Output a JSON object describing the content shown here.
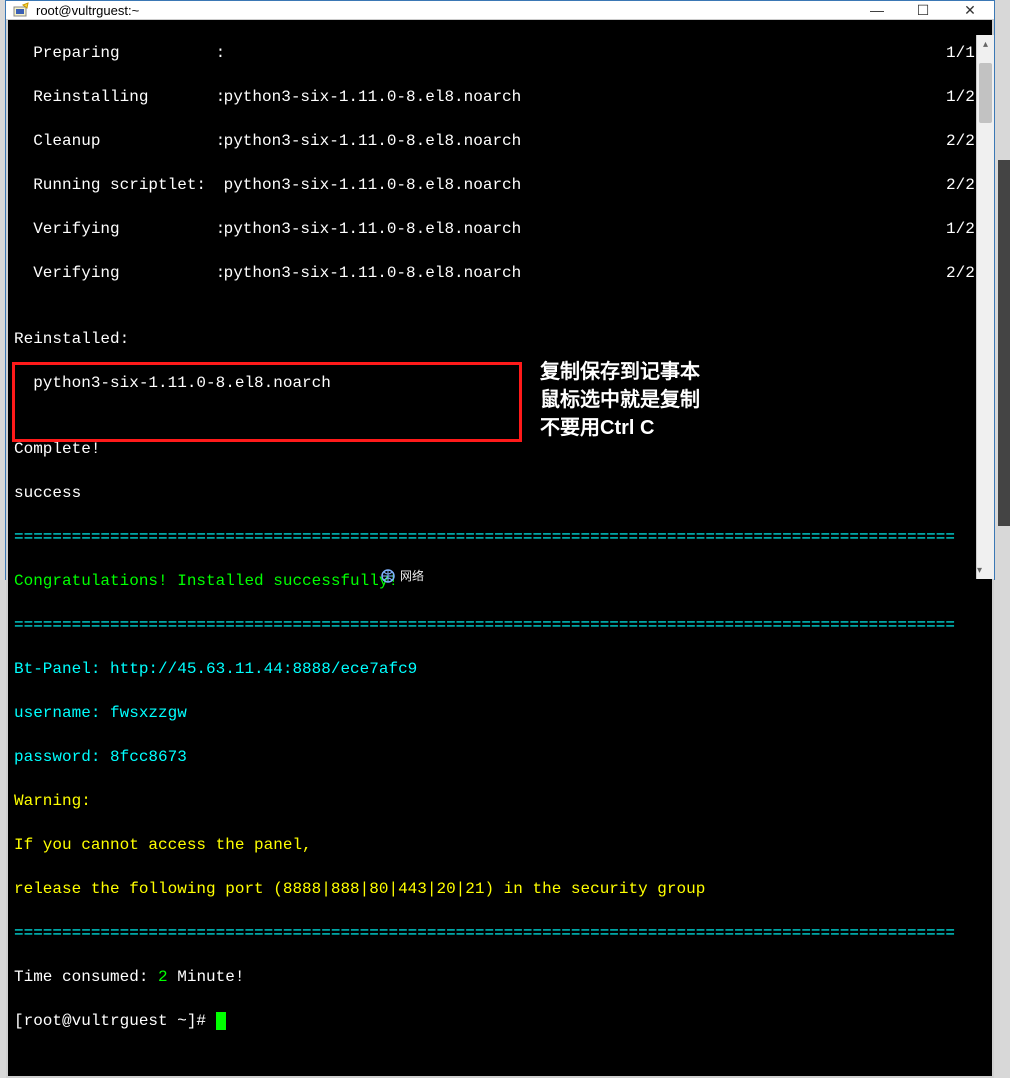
{
  "window": {
    "title": "root@vultrguest:~",
    "min_label": "—",
    "max_label": "☐",
    "close_label": "✕"
  },
  "install": {
    "rows": [
      {
        "label": "  Preparing          :",
        "pkg": "",
        "count": "1/1"
      },
      {
        "label": "  Reinstalling       :",
        "pkg": " python3-six-1.11.0-8.el8.noarch",
        "count": "1/2"
      },
      {
        "label": "  Cleanup            :",
        "pkg": " python3-six-1.11.0-8.el8.noarch",
        "count": "2/2"
      },
      {
        "label": "  Running scriptlet:",
        "pkg": " python3-six-1.11.0-8.el8.noarch",
        "count": "2/2"
      },
      {
        "label": "  Verifying          :",
        "pkg": " python3-six-1.11.0-8.el8.noarch",
        "count": "1/2"
      },
      {
        "label": "  Verifying          :",
        "pkg": " python3-six-1.11.0-8.el8.noarch",
        "count": "2/2"
      }
    ],
    "blank1": "",
    "reinstalled_hdr": "Reinstalled:",
    "reinstalled_pkg": "  python3-six-1.11.0-8.el8.noarch",
    "blank2": "",
    "complete": "Complete!",
    "success": "success",
    "divider1": "==================================================================================================",
    "congrats": "Congratulations! Installed successfully!",
    "divider2": "==================================================================================================",
    "panel_url": "Bt-Panel: http://45.63.11.44:8888/ece7afc9",
    "username": "username: fwsxzzgw",
    "password": "password: 8fcc8673",
    "warning_hdr": "Warning:",
    "warn_line1": "If you cannot access the panel, ",
    "warn_line2": "release the following port (8888|888|80|443|20|21) in the security group",
    "divider3": "==================================================================================================",
    "time_pre": "Time consumed: ",
    "time_val": "2",
    "time_post": " Minute!",
    "prompt": "[root@vultrguest ~]# "
  },
  "annotation": {
    "l1": "复制保存到记事本",
    "l2": "鼠标选中就是复制",
    "l3": "不要用Ctrl C"
  },
  "taskbar": {
    "network": "网络"
  }
}
